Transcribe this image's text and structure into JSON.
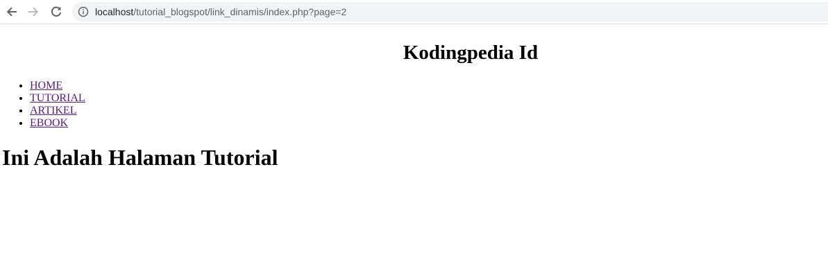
{
  "browser": {
    "url_host": "localhost",
    "url_path": "/tutorial_blogspot/link_dinamis/index.php?page=2",
    "icons": [
      "back-arrow-icon",
      "forward-arrow-icon",
      "reload-icon",
      "info-icon"
    ]
  },
  "site": {
    "title": "Kodingpedia Id"
  },
  "menu": {
    "items": [
      {
        "label": "HOME"
      },
      {
        "label": "TUTORIAL"
      },
      {
        "label": "ARTIKEL"
      },
      {
        "label": "EBOOK"
      }
    ]
  },
  "content": {
    "heading": "Ini Adalah Halaman Tutorial"
  },
  "colors": {
    "visited_link": "#551a8b",
    "omnibox_bg": "#f1f3f4",
    "icon_gray": "#5f6368"
  }
}
